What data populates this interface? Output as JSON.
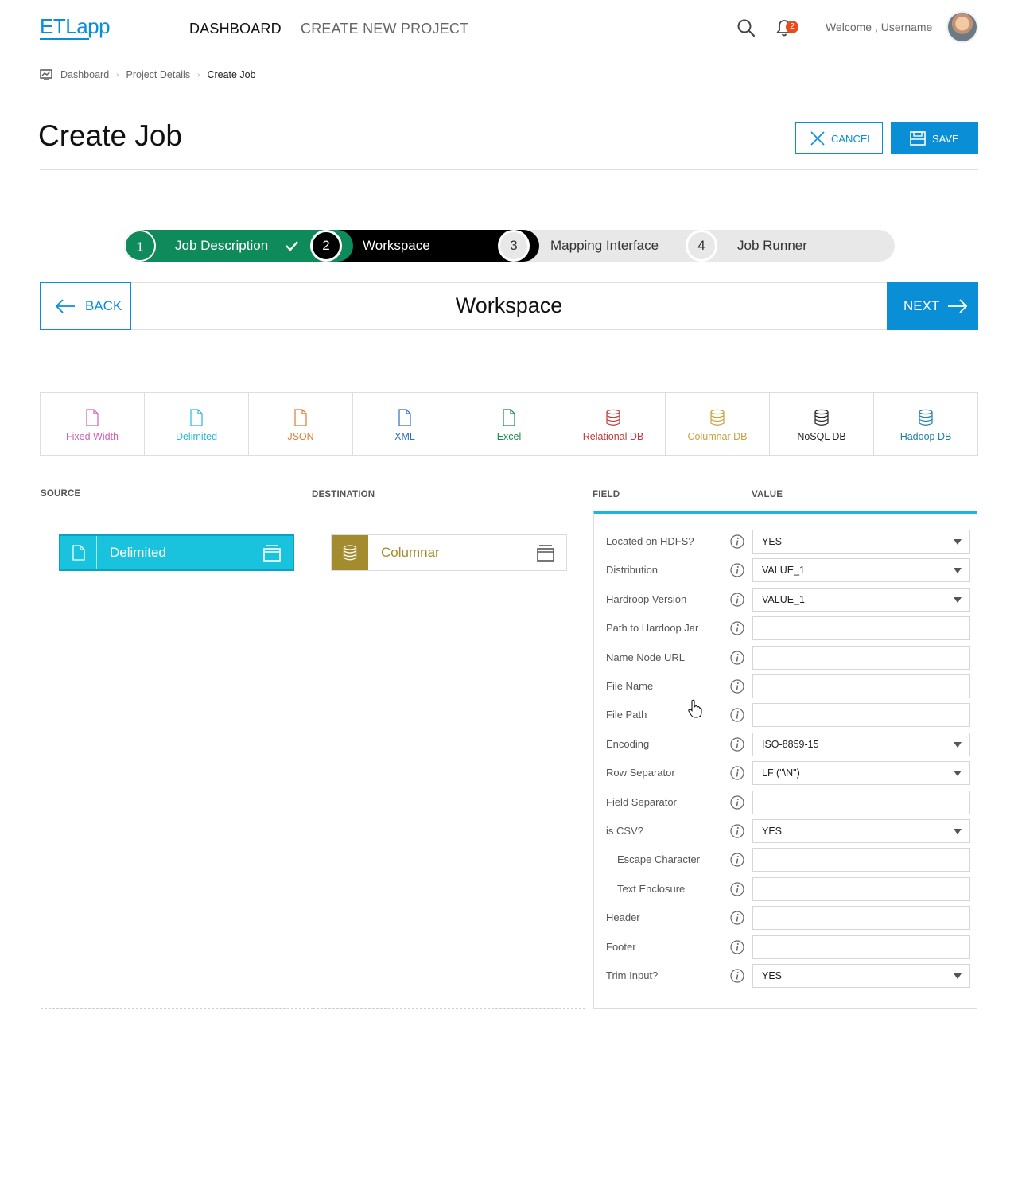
{
  "app": {
    "logo_etl": "ETL",
    "logo_app": "app",
    "brand_color": "#0a8fd6"
  },
  "nav": {
    "dashboard": "DASHBOARD",
    "create_project": "CREATE NEW PROJECT"
  },
  "header": {
    "notification_count": "2",
    "welcome": "Welcome , Username"
  },
  "breadcrumb": {
    "items": [
      "Dashboard",
      "Project Details"
    ],
    "current": "Create Job"
  },
  "page": {
    "title": "Create Job",
    "cancel_label": "CANCEL",
    "save_label": "SAVE"
  },
  "stepper": {
    "steps": [
      {
        "num": "1",
        "label": "Job Description",
        "state": "completed"
      },
      {
        "num": "2",
        "label": "Workspace",
        "state": "active"
      },
      {
        "num": "3",
        "label": "Mapping Interface",
        "state": "pending"
      },
      {
        "num": "4",
        "label": "Job Runner",
        "state": "pending"
      }
    ]
  },
  "workspace": {
    "back_label": "BACK",
    "title": "Workspace",
    "next_label": "NEXT"
  },
  "palette": [
    {
      "label": "Fixed Width",
      "icon": "file-icon",
      "color": "#d45fb3"
    },
    {
      "label": "Delimited",
      "icon": "file-icon",
      "color": "#29b8d8"
    },
    {
      "label": "JSON",
      "icon": "file-icon",
      "color": "#e07a2e"
    },
    {
      "label": "XML",
      "icon": "file-icon",
      "color": "#2f6fc0"
    },
    {
      "label": "Excel",
      "icon": "file-icon",
      "color": "#1c8a4e"
    },
    {
      "label": "Relational DB",
      "icon": "database-icon",
      "color": "#c0393b"
    },
    {
      "label": "Columnar DB",
      "icon": "database-icon",
      "color": "#c7a23a"
    },
    {
      "label": "NoSQL DB",
      "icon": "database-icon",
      "color": "#222222"
    },
    {
      "label": "Hadoop DB",
      "icon": "database-icon",
      "color": "#1d7fa6"
    }
  ],
  "source": {
    "heading": "SOURCE",
    "node_label": "Delimited"
  },
  "destination": {
    "heading": "DESTINATION",
    "node_label": "Columnar"
  },
  "fields_panel": {
    "field_heading": "FIELD",
    "value_heading": "VALUE",
    "rows": [
      {
        "label": "Located on HDFS?",
        "value": "YES",
        "type": "select",
        "indent": false
      },
      {
        "label": "Distribution",
        "value": "VALUE_1",
        "type": "select",
        "indent": false
      },
      {
        "label": "Hardroop Version",
        "value": "VALUE_1",
        "type": "select",
        "indent": false
      },
      {
        "label": "Path to Hardoop Jar",
        "value": "",
        "type": "text",
        "indent": false
      },
      {
        "label": "Name Node URL",
        "value": "",
        "type": "text",
        "indent": false
      },
      {
        "label": "File Name",
        "value": "",
        "type": "text",
        "indent": false
      },
      {
        "label": "File Path",
        "value": "",
        "type": "text",
        "indent": false
      },
      {
        "label": "Encoding",
        "value": "ISO-8859-15",
        "type": "select",
        "indent": false
      },
      {
        "label": "Row Separator",
        "value": "LF (\"\\N\")",
        "type": "select",
        "indent": false
      },
      {
        "label": "Field Separator",
        "value": "",
        "type": "text",
        "indent": false
      },
      {
        "label": "is CSV?",
        "value": "YES",
        "type": "select",
        "indent": false
      },
      {
        "label": "Escape Character",
        "value": "",
        "type": "text",
        "indent": true
      },
      {
        "label": "Text Enclosure",
        "value": "",
        "type": "text",
        "indent": true
      },
      {
        "label": "Header",
        "value": "",
        "type": "text",
        "indent": false
      },
      {
        "label": "Footer",
        "value": "",
        "type": "text",
        "indent": false
      },
      {
        "label": "Trim Input?",
        "value": "YES",
        "type": "select",
        "indent": false
      }
    ]
  }
}
